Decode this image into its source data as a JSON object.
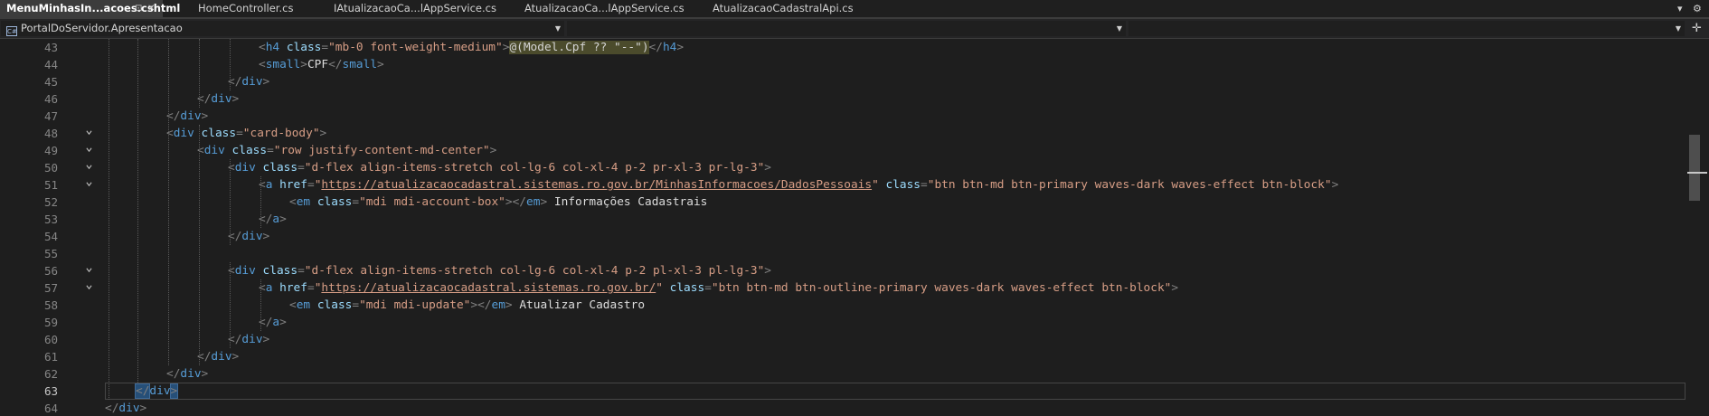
{
  "tabs": [
    {
      "label": "MenuMinhasIn...acoes.cshtml",
      "active": true
    },
    {
      "label": "HomeController.cs",
      "active": false
    },
    {
      "label": "IAtualizacaoCa...lAppService.cs",
      "active": false
    },
    {
      "label": "AtualizacaoCa...lAppService.cs",
      "active": false
    },
    {
      "label": "AtualizacaoCadastralApi.cs",
      "active": false
    }
  ],
  "tab_pin_icon": "⊡",
  "tab_close_icon": "✕",
  "tab_overflow_icon": "▾",
  "settings_icon": "⚙",
  "nav": {
    "project_icon": "C#",
    "project": "PortalDoServidor.Apresentacao",
    "member": "",
    "symbol": "",
    "split_icon": "✛"
  },
  "editor": {
    "current_line": 63,
    "lines": [
      {
        "n": 43,
        "fold": false,
        "tokens": [
          [
            "d",
            "            "
          ],
          [
            "t",
            "<"
          ],
          [
            "tag",
            "h4"
          ],
          [
            "a",
            " class"
          ],
          [
            "t",
            "="
          ],
          [
            "s",
            "\"mb-0 font-weight-medium\""
          ],
          [
            "t",
            ">"
          ],
          [
            "rz",
            "@(Model.Cpf ?? \"--\")"
          ],
          [
            "t",
            "</"
          ],
          [
            "tag",
            "h4"
          ],
          [
            "t",
            ">"
          ]
        ]
      },
      {
        "n": 44,
        "fold": false,
        "tokens": [
          [
            "d",
            "            "
          ],
          [
            "t",
            "<"
          ],
          [
            "tag",
            "small"
          ],
          [
            "t",
            ">"
          ],
          [
            "x",
            "CPF"
          ],
          [
            "t",
            "</"
          ],
          [
            "tag",
            "small"
          ],
          [
            "t",
            ">"
          ]
        ]
      },
      {
        "n": 45,
        "fold": false,
        "tokens": [
          [
            "d",
            "        "
          ],
          [
            "t",
            "</"
          ],
          [
            "tag",
            "div"
          ],
          [
            "t",
            ">"
          ]
        ]
      },
      {
        "n": 46,
        "fold": false,
        "tokens": [
          [
            "d",
            "      "
          ],
          [
            "t",
            "</"
          ],
          [
            "tag",
            "div"
          ],
          [
            "t",
            ">"
          ]
        ]
      },
      {
        "n": 47,
        "fold": false,
        "tokens": [
          [
            "d",
            "  "
          ],
          [
            "t",
            "</"
          ],
          [
            "tag",
            "div"
          ],
          [
            "t",
            ">"
          ]
        ]
      },
      {
        "n": 48,
        "fold": true,
        "tokens": [
          [
            "t",
            "<"
          ],
          [
            "tag",
            "div"
          ],
          [
            "a",
            " class"
          ],
          [
            "t",
            "="
          ],
          [
            "s",
            "\"card-body\""
          ],
          [
            "t",
            ">"
          ]
        ]
      },
      {
        "n": 49,
        "fold": true,
        "tokens": [
          [
            "d",
            "    "
          ],
          [
            "t",
            "<"
          ],
          [
            "tag",
            "div"
          ],
          [
            "a",
            " class"
          ],
          [
            "t",
            "="
          ],
          [
            "s",
            "\"row justify-content-md-center\""
          ],
          [
            "t",
            ">"
          ]
        ]
      },
      {
        "n": 50,
        "fold": true,
        "tokens": [
          [
            "d",
            "        "
          ],
          [
            "t",
            "<"
          ],
          [
            "tag",
            "div"
          ],
          [
            "a",
            " class"
          ],
          [
            "t",
            "="
          ],
          [
            "s",
            "\"d-flex align-items-stretch col-lg-6 col-xl-4 p-2 pr-xl-3 pr-lg-3\""
          ],
          [
            "t",
            ">"
          ]
        ]
      },
      {
        "n": 51,
        "fold": true,
        "tokens": [
          [
            "d",
            "            "
          ],
          [
            "t",
            "<"
          ],
          [
            "tag",
            "a"
          ],
          [
            "a",
            " href"
          ],
          [
            "t",
            "="
          ],
          [
            "s",
            "\""
          ],
          [
            "l",
            "https://atualizacaocadastral.sistemas.ro.gov.br/MinhasInformacoes/DadosPessoais"
          ],
          [
            "s",
            "\""
          ],
          [
            "a",
            " class"
          ],
          [
            "t",
            "="
          ],
          [
            "s",
            "\"btn btn-md btn-primary waves-dark waves-effect btn-block\""
          ],
          [
            "t",
            ">"
          ]
        ]
      },
      {
        "n": 52,
        "fold": false,
        "tokens": [
          [
            "d",
            "                "
          ],
          [
            "t",
            "<"
          ],
          [
            "tag",
            "em"
          ],
          [
            "a",
            " class"
          ],
          [
            "t",
            "="
          ],
          [
            "s",
            "\"mdi mdi-account-box\""
          ],
          [
            "t",
            "></"
          ],
          [
            "tag",
            "em"
          ],
          [
            "t",
            "> "
          ],
          [
            "x",
            "Informações Cadastrais"
          ]
        ]
      },
      {
        "n": 53,
        "fold": false,
        "tokens": [
          [
            "d",
            "            "
          ],
          [
            "t",
            "</"
          ],
          [
            "tag",
            "a"
          ],
          [
            "t",
            ">"
          ]
        ]
      },
      {
        "n": 54,
        "fold": false,
        "tokens": [
          [
            "d",
            "        "
          ],
          [
            "t",
            "</"
          ],
          [
            "tag",
            "div"
          ],
          [
            "t",
            ">"
          ]
        ]
      },
      {
        "n": 55,
        "fold": false,
        "tokens": []
      },
      {
        "n": 56,
        "fold": true,
        "tokens": [
          [
            "d",
            "        "
          ],
          [
            "t",
            "<"
          ],
          [
            "tag",
            "div"
          ],
          [
            "a",
            " class"
          ],
          [
            "t",
            "="
          ],
          [
            "s",
            "\"d-flex align-items-stretch col-lg-6 col-xl-4 p-2 pl-xl-3 pl-lg-3\""
          ],
          [
            "t",
            ">"
          ]
        ]
      },
      {
        "n": 57,
        "fold": true,
        "tokens": [
          [
            "d",
            "            "
          ],
          [
            "t",
            "<"
          ],
          [
            "tag",
            "a"
          ],
          [
            "a",
            " href"
          ],
          [
            "t",
            "="
          ],
          [
            "s",
            "\""
          ],
          [
            "l",
            "https://atualizacaocadastral.sistemas.ro.gov.br/"
          ],
          [
            "s",
            "\""
          ],
          [
            "a",
            " class"
          ],
          [
            "t",
            "="
          ],
          [
            "s",
            "\"btn btn-md btn-outline-primary waves-dark waves-effect btn-block\""
          ],
          [
            "t",
            ">"
          ]
        ]
      },
      {
        "n": 58,
        "fold": false,
        "tokens": [
          [
            "d",
            "                "
          ],
          [
            "t",
            "<"
          ],
          [
            "tag",
            "em"
          ],
          [
            "a",
            " class"
          ],
          [
            "t",
            "="
          ],
          [
            "s",
            "\"mdi mdi-update\""
          ],
          [
            "t",
            "></"
          ],
          [
            "tag",
            "em"
          ],
          [
            "t",
            "> "
          ],
          [
            "x",
            "Atualizar Cadastro"
          ]
        ]
      },
      {
        "n": 59,
        "fold": false,
        "tokens": [
          [
            "d",
            "            "
          ],
          [
            "t",
            "</"
          ],
          [
            "tag",
            "a"
          ],
          [
            "t",
            ">"
          ]
        ]
      },
      {
        "n": 60,
        "fold": false,
        "tokens": [
          [
            "d",
            "        "
          ],
          [
            "t",
            "</"
          ],
          [
            "tag",
            "div"
          ],
          [
            "t",
            ">"
          ]
        ]
      },
      {
        "n": 61,
        "fold": false,
        "tokens": [
          [
            "d",
            "    "
          ],
          [
            "t",
            "</"
          ],
          [
            "tag",
            "div"
          ],
          [
            "t",
            ">"
          ]
        ]
      },
      {
        "n": 62,
        "fold": false,
        "tokens": [
          [
            "t",
            "</"
          ],
          [
            "tag",
            "div"
          ],
          [
            "t",
            ">"
          ]
        ]
      },
      {
        "n": 63,
        "fold": false,
        "tokens": [
          [
            "h",
            "</"
          ],
          [
            "tag",
            "div"
          ],
          [
            "h",
            ">"
          ]
        ]
      },
      {
        "n": 64,
        "fold": false,
        "tokens": [
          [
            "t",
            "</"
          ],
          [
            "tag",
            "div"
          ],
          [
            "t",
            ">"
          ]
        ]
      }
    ]
  },
  "colors": {
    "background": "#1e1e1e",
    "tag": "#569cd6",
    "attribute": "#9cdcfe",
    "string": "#d69d85",
    "delimiter": "#808080",
    "text": "#dcdcdc",
    "bracket_highlight": "#264f78"
  }
}
